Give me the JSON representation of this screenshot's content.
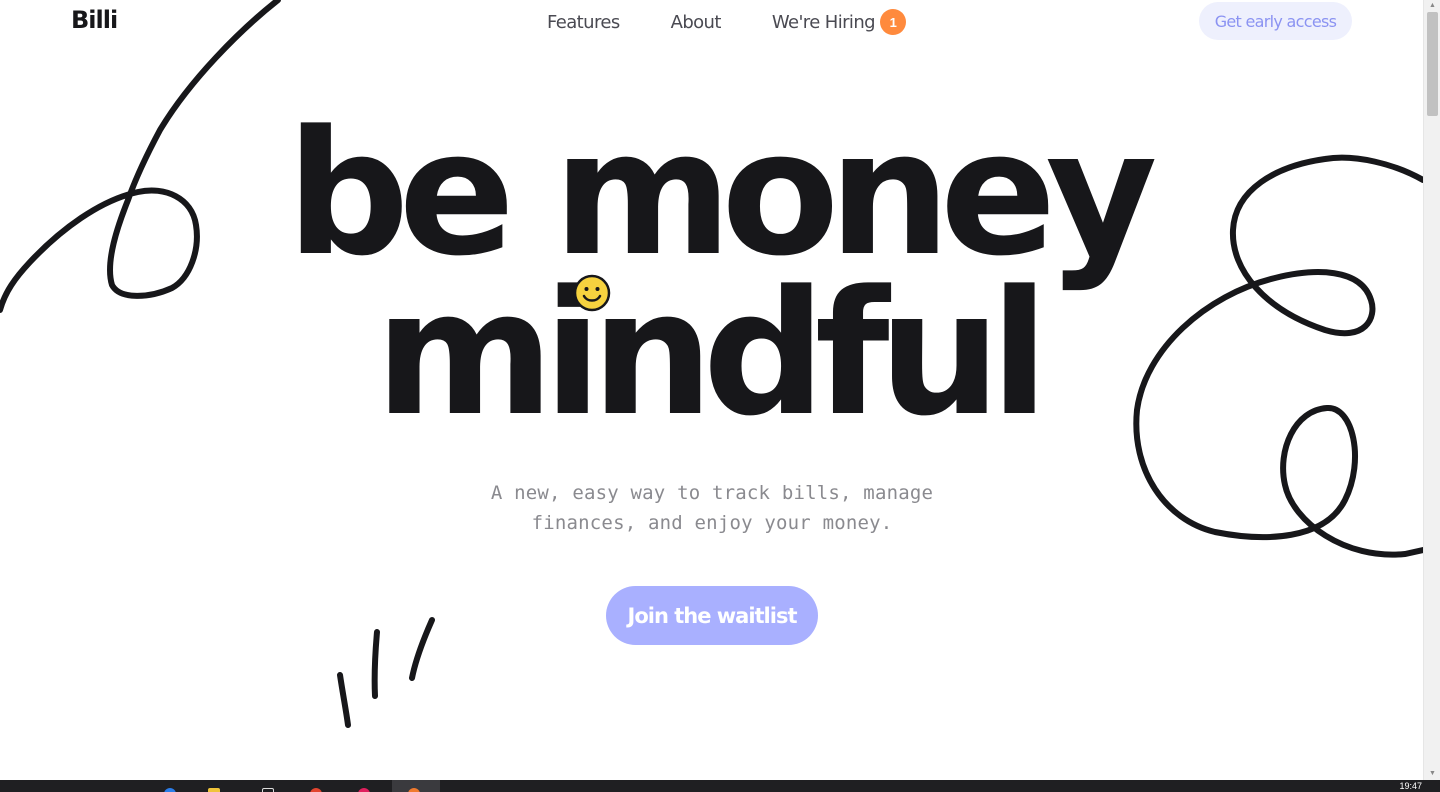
{
  "brand": {
    "name": "Billi"
  },
  "nav": {
    "features": "Features",
    "about": "About",
    "hiring": "We're Hiring",
    "hiring_badge": "1",
    "cta": "Get early access"
  },
  "hero": {
    "line1": "be money",
    "line2": "mindful",
    "subtitle_line1": "A new, easy way to track bills, manage",
    "subtitle_line2": "finances, and enjoy your money.",
    "cta": "Join the waitlist"
  },
  "colors": {
    "text": "#17171a",
    "nav_text": "#4a4a52",
    "badge": "#ff8a3d",
    "cta_top_bg": "#eef0fd",
    "cta_top_text": "#8b93f2",
    "waitlist_bg": "#a9b0ff",
    "subtitle": "#8a8a8f",
    "smiley": "#f6d23f"
  },
  "icons": {
    "smiley": "smiley-face-icon"
  },
  "taskbar": {
    "clock": "19:47"
  }
}
